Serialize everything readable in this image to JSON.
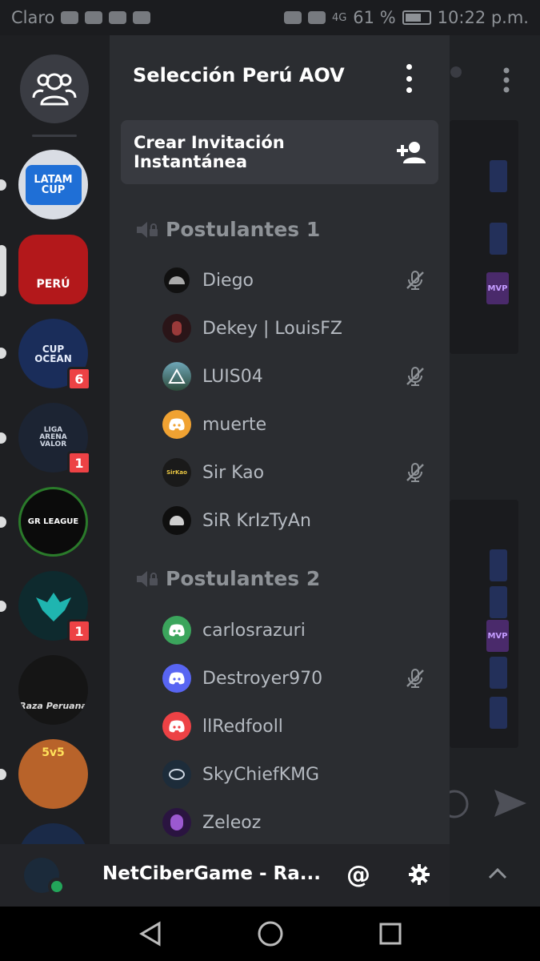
{
  "status_bar": {
    "carrier": "Claro",
    "signal": "4G",
    "battery": "61 %",
    "time": "10:22 p.m."
  },
  "rail": {
    "guilds": [
      {
        "name": "LATAM CUP",
        "badge": ""
      },
      {
        "name": "PERÚ",
        "badge": ""
      },
      {
        "name": "CUP OCEAN",
        "badge": "6"
      },
      {
        "name": "LIGA ARENA VALOR",
        "badge": "1"
      },
      {
        "name": "GR LEAGUE",
        "badge": ""
      },
      {
        "name": "",
        "badge": "1"
      },
      {
        "name": "Raza Peruana",
        "badge": ""
      },
      {
        "name": "5v5",
        "badge": ""
      }
    ]
  },
  "drawer": {
    "server_name": "Selección Perú AOV",
    "invite_label": "Crear Invitación Instantánea",
    "categories": [
      {
        "name": "Postulantes 1"
      },
      {
        "name": "Postulantes 2"
      }
    ],
    "members": [
      {
        "name": "Diego",
        "muted": true
      },
      {
        "name": "Dekey | LouisFZ",
        "muted": false
      },
      {
        "name": "LUIS04",
        "muted": true
      },
      {
        "name": "muerte",
        "muted": false
      },
      {
        "name": "Sir Kao",
        "muted": true
      },
      {
        "name": "SiR KrIzTyAn",
        "muted": false
      },
      {
        "name": "carlosrazuri",
        "muted": false
      },
      {
        "name": "Destroyer970",
        "muted": true
      },
      {
        "name": "llRedfooll",
        "muted": false
      },
      {
        "name": "SkyChiefKMG",
        "muted": false
      },
      {
        "name": "Zeleoz",
        "muted": false
      }
    ]
  },
  "user_panel": {
    "username": "NetCiberGame - Ra...",
    "mention_icon": "@"
  },
  "colors": {
    "accent": "#5865f2",
    "online": "#23a55a",
    "badge": "#ed4245",
    "drawer_bg": "#2b2d31",
    "rail_bg": "#1e1f22"
  }
}
